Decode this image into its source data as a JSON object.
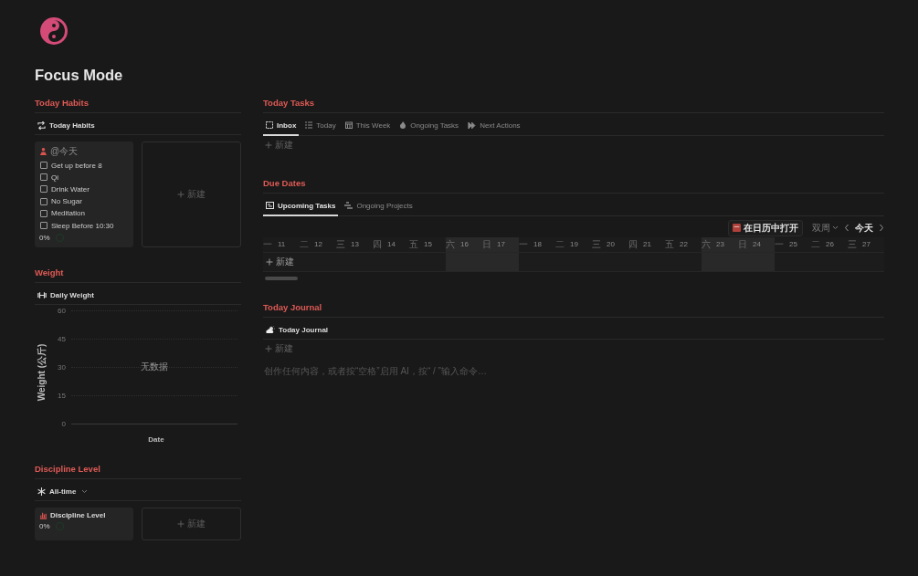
{
  "page": {
    "title": "Focus Mode"
  },
  "left": {
    "habits": {
      "heading": "Today Habits",
      "view": "Today Habits",
      "card": {
        "title": "@今天",
        "items": [
          {
            "label": "Get up before 8",
            "checked": false
          },
          {
            "label": "Qi",
            "checked": false
          },
          {
            "label": "Drink Water",
            "checked": false
          },
          {
            "label": "No Sugar",
            "checked": false
          },
          {
            "label": "Meditation",
            "checked": false
          },
          {
            "label": "Sleep Before 10:30",
            "checked": false
          }
        ],
        "percent": "0%"
      },
      "new_label": "新建"
    },
    "weight": {
      "heading": "Weight",
      "view": "Daily Weight",
      "empty_message": "无数据",
      "x_title": "Date",
      "y_title": "Weight (公斤)",
      "y_ticks": [
        "60",
        "45",
        "30",
        "15",
        "0"
      ]
    },
    "discipline": {
      "heading": "Discipline Level",
      "view": "All-time",
      "card": {
        "title": "Discipline Level",
        "percent": "0%"
      },
      "new_label": "新建"
    }
  },
  "right": {
    "tasks": {
      "heading": "Today Tasks",
      "tabs": [
        {
          "label": "Inbox",
          "selected": true,
          "kind": "square"
        },
        {
          "label": "Today",
          "selected": false,
          "kind": "list"
        },
        {
          "label": "This Week",
          "selected": false,
          "kind": "calendar"
        },
        {
          "label": "Ongoing Tasks",
          "selected": false,
          "kind": "fire"
        },
        {
          "label": "Next Actions",
          "selected": false,
          "kind": "skip"
        }
      ],
      "new_label": "新建"
    },
    "due": {
      "heading": "Due Dates",
      "tabs": [
        {
          "label": "Upcoming Tasks",
          "selected": true,
          "kind": "timeline"
        },
        {
          "label": "Ongoing Projects",
          "selected": false,
          "kind": "stairs"
        }
      ],
      "open_button": "在日历中打开",
      "range": "双周",
      "today": "今天",
      "days": [
        {
          "weekday": "一",
          "day": "11",
          "weekend": false
        },
        {
          "weekday": "二",
          "day": "12",
          "weekend": false
        },
        {
          "weekday": "三",
          "day": "13",
          "weekend": false
        },
        {
          "weekday": "四",
          "day": "14",
          "weekend": false
        },
        {
          "weekday": "五",
          "day": "15",
          "weekend": false
        },
        {
          "weekday": "六",
          "day": "16",
          "weekend": true
        },
        {
          "weekday": "日",
          "day": "17",
          "weekend": true
        },
        {
          "weekday": "一",
          "day": "18",
          "weekend": false
        },
        {
          "weekday": "二",
          "day": "19",
          "weekend": false
        },
        {
          "weekday": "三",
          "day": "20",
          "weekend": false
        },
        {
          "weekday": "四",
          "day": "21",
          "weekend": false
        },
        {
          "weekday": "五",
          "day": "22",
          "weekend": false
        },
        {
          "weekday": "六",
          "day": "23",
          "weekend": true
        },
        {
          "weekday": "日",
          "day": "24",
          "weekend": true
        },
        {
          "weekday": "一",
          "day": "25",
          "weekend": false
        },
        {
          "weekday": "二",
          "day": "26",
          "weekend": false
        },
        {
          "weekday": "三",
          "day": "27",
          "weekend": false
        }
      ],
      "new_label": "新建"
    },
    "journal": {
      "heading": "Today Journal",
      "view": "Today Journal",
      "new_label": "新建",
      "placeholder": "创作任何内容，或者按“空格”启用 AI，按“ / ”输入命令…"
    }
  }
}
